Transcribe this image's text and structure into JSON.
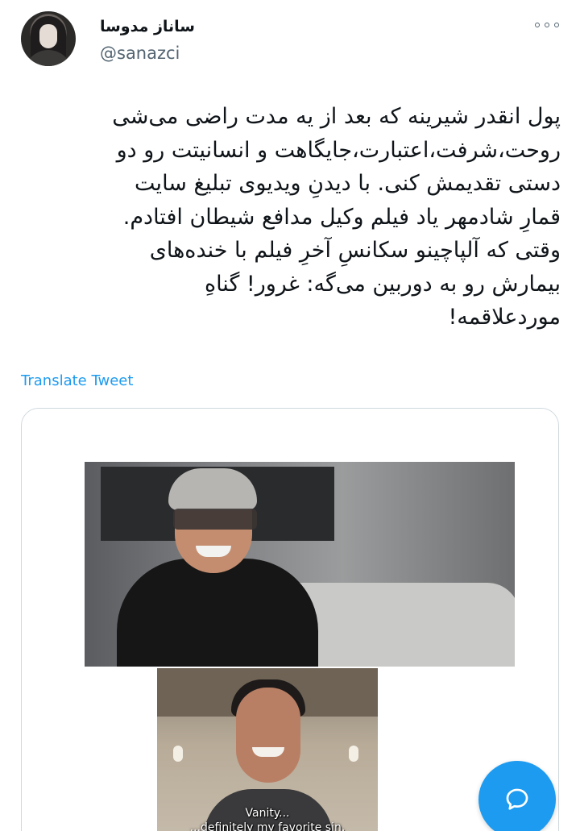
{
  "user": {
    "display_name": "ساناز مدوسا",
    "handle": "@sanazci"
  },
  "header": {
    "more_icon": "more-dots-icon"
  },
  "tweet": {
    "text": "پول انقدر شیرینه که بعد از یه مدت راضی می‌شی\nروحت،شرفت،اعتبارت،جایگاهت و انسانیتت رو دو\nدستی تقدیمش کنی. با دیدنِ ویدیوی تبلیغ سایت\nقمارِ شادمهر یاد فیلم وکیل مدافع شیطان افتادم.\nوقتی که آلپاچینو سکانسِ آخرِ فیلم با خنده‌های\nبیمارش رو به دوربین می‌گه: غرور! گناهِ\nموردعلاقمه!",
    "translate_label": "Translate Tweet"
  },
  "media": {
    "subtitle_line1": "Vanity...",
    "subtitle_line2": "...definitely my favorite sin."
  },
  "fab": {
    "icon": "compose-reply-icon",
    "color": "#1d9bf0"
  },
  "colors": {
    "accent": "#1d9bf0",
    "text": "#0f1419",
    "secondary": "#536471"
  }
}
